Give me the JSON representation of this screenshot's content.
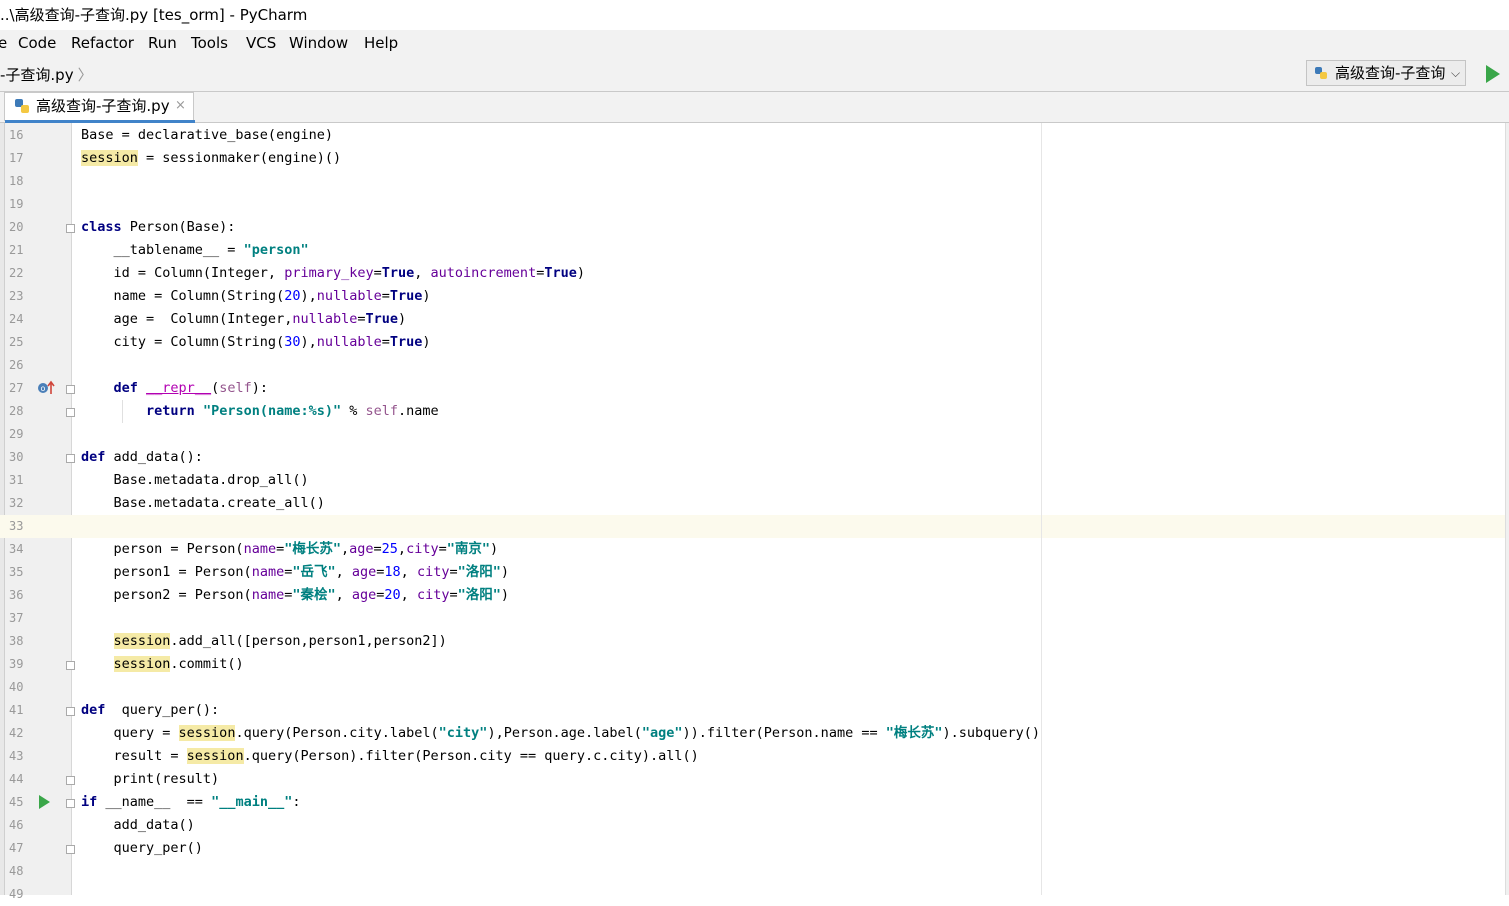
{
  "window": {
    "title": "..\\高级查询-子查询.py [tes_orm] - PyCharm"
  },
  "menu": [
    {
      "label": "e"
    },
    {
      "label": "Code"
    },
    {
      "label": "Refactor"
    },
    {
      "label": "Run"
    },
    {
      "label": "Tools"
    },
    {
      "label": "VCS"
    },
    {
      "label": "Window"
    },
    {
      "label": "Help"
    }
  ],
  "navbar": {
    "breadcrumb": "-子查询.py",
    "run_config": "高级查询-子查询"
  },
  "tab": {
    "label": "高级查询-子查询.py",
    "close": "×"
  },
  "editor": {
    "current_line": 33,
    "lines": [
      {
        "n": "16",
        "code": "Base = declarative_base(engine)"
      },
      {
        "n": "17",
        "code": "session = sessionmaker(engine)()"
      },
      {
        "n": "18",
        "code": ""
      },
      {
        "n": "19",
        "code": ""
      },
      {
        "n": "20",
        "code": "class Person(Base):"
      },
      {
        "n": "21",
        "code": "    __tablename__ = \"person\""
      },
      {
        "n": "22",
        "code": "    id = Column(Integer, primary_key=True, autoincrement=True)"
      },
      {
        "n": "23",
        "code": "    name = Column(String(20),nullable=True)"
      },
      {
        "n": "24",
        "code": "    age =  Column(Integer,nullable=True)"
      },
      {
        "n": "25",
        "code": "    city = Column(String(30),nullable=True)"
      },
      {
        "n": "26",
        "code": ""
      },
      {
        "n": "27",
        "code": "    def __repr__(self):"
      },
      {
        "n": "28",
        "code": "        return \"Person(name:%s)\" % self.name"
      },
      {
        "n": "29",
        "code": ""
      },
      {
        "n": "30",
        "code": "def add_data():"
      },
      {
        "n": "31",
        "code": "    Base.metadata.drop_all()"
      },
      {
        "n": "32",
        "code": "    Base.metadata.create_all()"
      },
      {
        "n": "33",
        "code": ""
      },
      {
        "n": "34",
        "code": "    person = Person(name=\"梅长苏\",age=25,city=\"南京\")"
      },
      {
        "n": "35",
        "code": "    person1 = Person(name=\"岳飞\", age=18, city=\"洛阳\")"
      },
      {
        "n": "36",
        "code": "    person2 = Person(name=\"秦桧\", age=20, city=\"洛阳\")"
      },
      {
        "n": "37",
        "code": ""
      },
      {
        "n": "38",
        "code": "    session.add_all([person,person1,person2])"
      },
      {
        "n": "39",
        "code": "    session.commit()"
      },
      {
        "n": "40",
        "code": ""
      },
      {
        "n": "41",
        "code": "def  query_per():"
      },
      {
        "n": "42",
        "code": "    query = session.query(Person.city.label(\"city\"),Person.age.label(\"age\")).filter(Person.name == \"梅长苏\").subquery()"
      },
      {
        "n": "43",
        "code": "    result = session.query(Person).filter(Person.city == query.c.city).all()"
      },
      {
        "n": "44",
        "code": "    print(result)"
      },
      {
        "n": "45",
        "code": "if __name__  == \"__main__\":"
      },
      {
        "n": "46",
        "code": "    add_data()"
      },
      {
        "n": "47",
        "code": "    query_per()"
      },
      {
        "n": "48",
        "code": ""
      },
      {
        "n": "49",
        "code": ""
      }
    ]
  },
  "colors": {
    "keyword": "#000080",
    "string": "#008080",
    "number": "#0000ff",
    "param": "#660099",
    "highlight": "#f5eaa6",
    "current_line": "#fcfaed",
    "run": "#3aa649"
  }
}
